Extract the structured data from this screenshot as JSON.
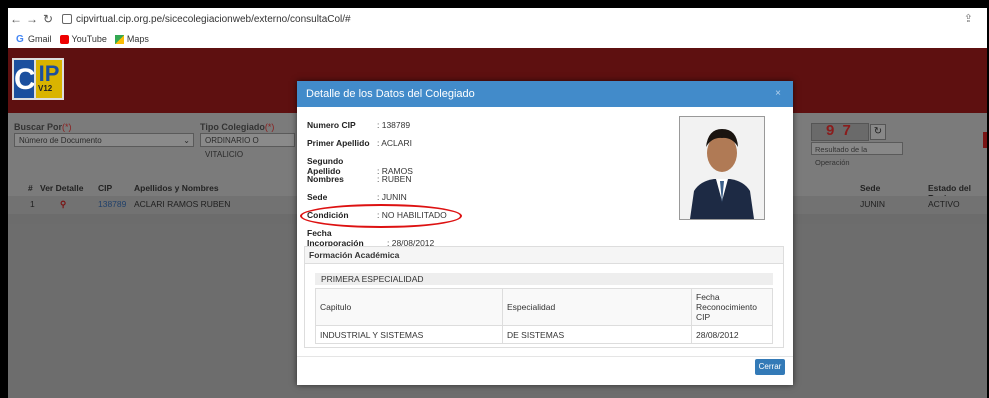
{
  "browser": {
    "url": "cipvirtual.cip.org.pe/sicecolegiacionweb/externo/consultaCol/#",
    "bookmarks": [
      {
        "label": "Gmail",
        "icon": "google-icon"
      },
      {
        "label": "YouTube",
        "icon": "youtube-icon"
      },
      {
        "label": "Maps",
        "icon": "maps-icon"
      }
    ]
  },
  "logo": {
    "top": "VIRTUAL",
    "sub": "V12",
    "letters_c": "C",
    "letters_ip": "IP"
  },
  "search": {
    "buscar_label": "Buscar Por",
    "buscar_req": "(*)",
    "buscar_value": "Número de Documento",
    "tipo_label": "Tipo Colegiado",
    "tipo_req": "(*)",
    "tipo_value": "ORDINARIO O VITALICIO",
    "captcha": "9 7",
    "result_label": "Resultado de la Operación"
  },
  "table": {
    "headers": {
      "num": "#",
      "ver": "Ver Detalle",
      "cip": "CIP",
      "nombres": "Apellidos y Nombres",
      "sede": "Sede",
      "estado": "Estado del Regi"
    },
    "row": {
      "num": "1",
      "cip": "138789",
      "nombres": "ACLARI RAMOS RUBEN",
      "sede": "JUNIN",
      "estado": "ACTIVO"
    }
  },
  "modal": {
    "title": "Detalle de los Datos del Colegiado",
    "close": "×",
    "fields": [
      {
        "key": "Numero CIP",
        "value": ": 138789"
      },
      {
        "key": "Primer Apellido",
        "value": ": ACLARI"
      },
      {
        "key": "Segundo Apellido",
        "value": ": RAMOS"
      },
      {
        "key": "Nombres",
        "value": ": RUBEN"
      },
      {
        "key": "Sede",
        "value": ": JUNIN"
      },
      {
        "key": "Condición",
        "value": ": NO HABILITADO"
      },
      {
        "key": "Fecha Incorporación",
        "value": ": 28/08/2012"
      }
    ],
    "formacion_title": "Formación Académica",
    "especialidad_header": "PRIMERA ESPECIALIDAD",
    "columns": [
      "Capitulo",
      "Especialidad",
      "Fecha Reconocimiento CIP"
    ],
    "rows": [
      [
        "INDUSTRIAL Y SISTEMAS",
        "DE SISTEMAS",
        "28/08/2012"
      ]
    ],
    "button": "Cerrar"
  }
}
